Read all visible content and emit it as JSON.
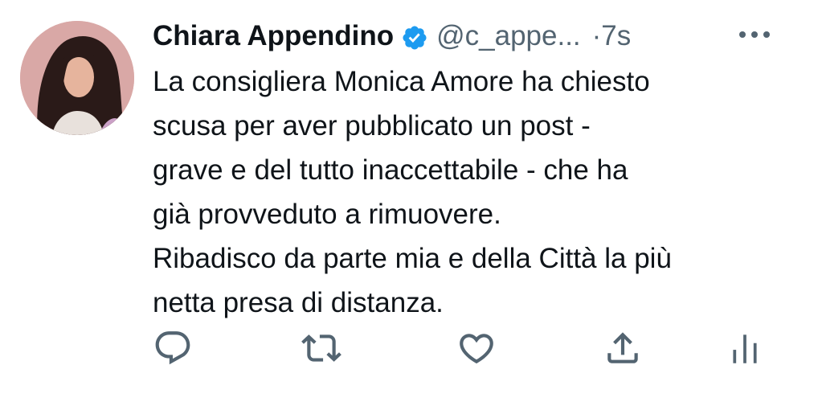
{
  "tweet": {
    "author": {
      "name": "Chiara Appendino",
      "handle": "@c_appe...",
      "verified": true,
      "avatar_icon": "profile-photo"
    },
    "time": "7s",
    "time_separator": "·",
    "more_icon": "more-horizontal-icon",
    "text_lines": [
      "La consigliera Monica Amore ha chiesto",
      "scusa per aver pubblicato un post -",
      "grave e del tutto inaccettabile - che ha",
      "già provveduto a rimuovere.",
      "Ribadisco da parte mia e della Città la più",
      "netta presa di distanza."
    ],
    "actions": [
      {
        "icon": "reply-icon"
      },
      {
        "icon": "retweet-icon"
      },
      {
        "icon": "like-icon"
      },
      {
        "icon": "share-icon"
      },
      {
        "icon": "analytics-icon"
      }
    ]
  },
  "colors": {
    "text": "#0f1419",
    "secondary": "#536471",
    "verified_blue": "#1d9bf0",
    "avatar_background": "#d9a8a6"
  }
}
